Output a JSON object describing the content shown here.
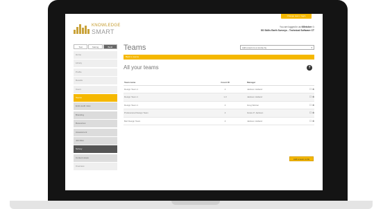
{
  "header": {
    "top_button": "Change team / login",
    "logo_line1": "KNOWLEDGE",
    "logo_line2": "SMART",
    "logged_in_prefix": "You are logged in as",
    "user_name": "Kfletcher",
    "org_line": "SS Skills Earth Surveys - Technical Software CT",
    "logout_icon": "logout-icon"
  },
  "sidebar": {
    "toggles": [
      {
        "label": "Test"
      },
      {
        "label": "Stating"
      },
      {
        "label": "Build"
      }
    ],
    "items": [
      {
        "label": "Home"
      },
      {
        "label": "Library"
      },
      {
        "label": "Profile"
      },
      {
        "label": "Results"
      },
      {
        "label": "Users"
      },
      {
        "label": "Teams"
      },
      {
        "label": "Ends audit rules"
      },
      {
        "label": "Branding"
      },
      {
        "label": "Resources"
      },
      {
        "label": "Assessment"
      },
      {
        "label": "Job titles"
      },
      {
        "label": "Survey"
      },
      {
        "label": "Content areas"
      },
      {
        "label": "Overview"
      }
    ]
  },
  "main": {
    "title": "Teams",
    "team_select": "Add a team to a course by",
    "yellow_bar": "Back to teams",
    "section_title": "All your teams",
    "help_icon_label": "?",
    "table": {
      "headers": [
        "Team name",
        "Count ID",
        "Manager",
        ""
      ],
      "rows": [
        {
          "name": "Design Team 1",
          "count": "4",
          "manager": "Jackson Holland",
          "actions": "☐ ⊗"
        },
        {
          "name": "Design Team 1",
          "count": "1.3",
          "manager": "Jackson Holland",
          "actions": "☐ ⊗"
        },
        {
          "name": "Design Team 1",
          "count": "4",
          "manager": "Greg Warren",
          "actions": "☐ ⊗"
        },
        {
          "name": "Professional Design Team",
          "count": "4",
          "manager": "Grace P. Jackson",
          "actions": "☐ ⊗"
        },
        {
          "name": "Bell Design Team",
          "count": "4",
          "manager": "Jackson Holland",
          "actions": "☐ ⊗"
        }
      ]
    },
    "add_button": "Add a team to list"
  },
  "colors": {
    "accent": "#f5b800",
    "bezel": "#141414",
    "nav_dark": "#555555"
  }
}
